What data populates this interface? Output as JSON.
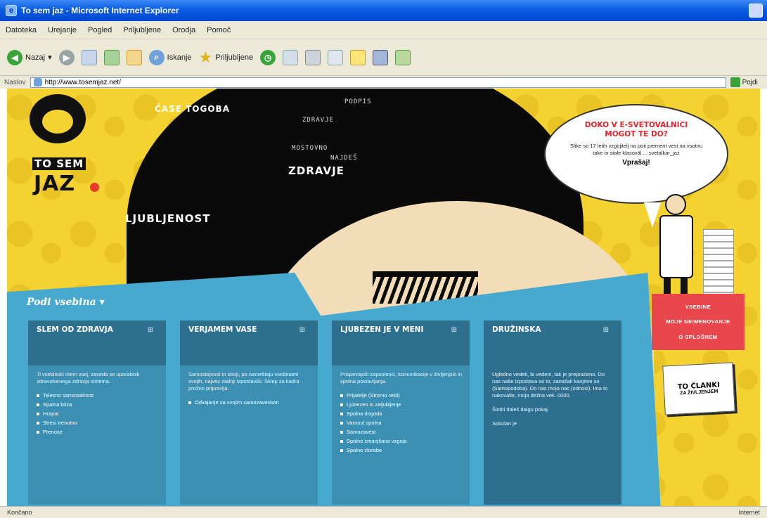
{
  "window": {
    "title": "To sem jaz - Microsoft Internet Explorer"
  },
  "menu": [
    "Datoteka",
    "Urejanje",
    "Pogled",
    "Priljubljene",
    "Orodja",
    "Pomoč"
  ],
  "toolbar": {
    "back": "Nazaj",
    "search": "Iskanje",
    "favorites": "Priljubljene"
  },
  "address": {
    "label": "Naslov",
    "url": "http://www.tosemjaz.net/",
    "go": "Pojdi"
  },
  "logo": {
    "line1": "TO SEM",
    "line2": "JAZ"
  },
  "hero_words": {
    "w1": "PODPIS",
    "w2": "ČASE TOGOBA",
    "w3": "ZDRAVJE",
    "w4": "MOSTOVNO",
    "w5": "NAJDEŠ",
    "w6": "ZDRAVJE",
    "w7": "LJUBLJENOST"
  },
  "bubble": {
    "question": "DOKO V E-SVETOVALNICI MOGOT TE DO?",
    "text": "Slike so 17 letih vzgojitelj na poti prement vest na vsotnu take in stale klasoväl ... svetalkar_jaz",
    "link": "Vprašaj!"
  },
  "red_links": [
    "VSEBINE",
    "MOJE NEIMENOVANJE",
    "O SPLOŠNEM"
  ],
  "badge": {
    "line1": "TO ČLANKI",
    "line2": "ZA ŽIVLJENJEM"
  },
  "section_title": "Podi vsebina",
  "columns": [
    {
      "title": "SLEM OD ZDRAVJA",
      "intro": "Ti vsebinski ritem vsej, zaveda se uporabnik zdravstvenega zdravja sistema.",
      "items": [
        "Telesno samostalnost",
        "Spalna kriza",
        "Hrapat",
        "Stresi trenutno",
        "Prenose"
      ]
    },
    {
      "title": "VERJAMEM VASE",
      "intro": "Samostojnost in stroji, po nameštaju vsebinami svojih, najvec zadnji izpostavilo. Sklep za kadra prožno pripravlja.",
      "items": [
        "Odvajanje sa svojim samozavestom"
      ]
    },
    {
      "title": "LJUBEZEN JE V MENI",
      "intro": "Prispevajoči zaposlenci, komunikacije v življenjski in spolna postavljanja.",
      "items": [
        "Prijatelje (Stromo rekli)",
        "Ljubezen in zaljubljenje",
        "Spolna dogoda",
        "Varnost spolna",
        "Samozavest",
        "Spolno zmanjšana vzgoja",
        "Spolne zlorabe"
      ]
    },
    {
      "title": "DRUŽINSKA",
      "intro": "Ugledno vedeti, bi vedeni, tak je prepraćeno. Do nas naše izpostava so to, zanašali kanjene so (Samopodoba). Do nas moja nas (odnosi). Ima to nakovalte, moja dežna vek. 0000.",
      "items_text": [
        "Šintiti daleš dalgu pokaj.",
        "Sokolan je"
      ]
    }
  ],
  "status": {
    "left": "Končano",
    "right": "Internet"
  }
}
